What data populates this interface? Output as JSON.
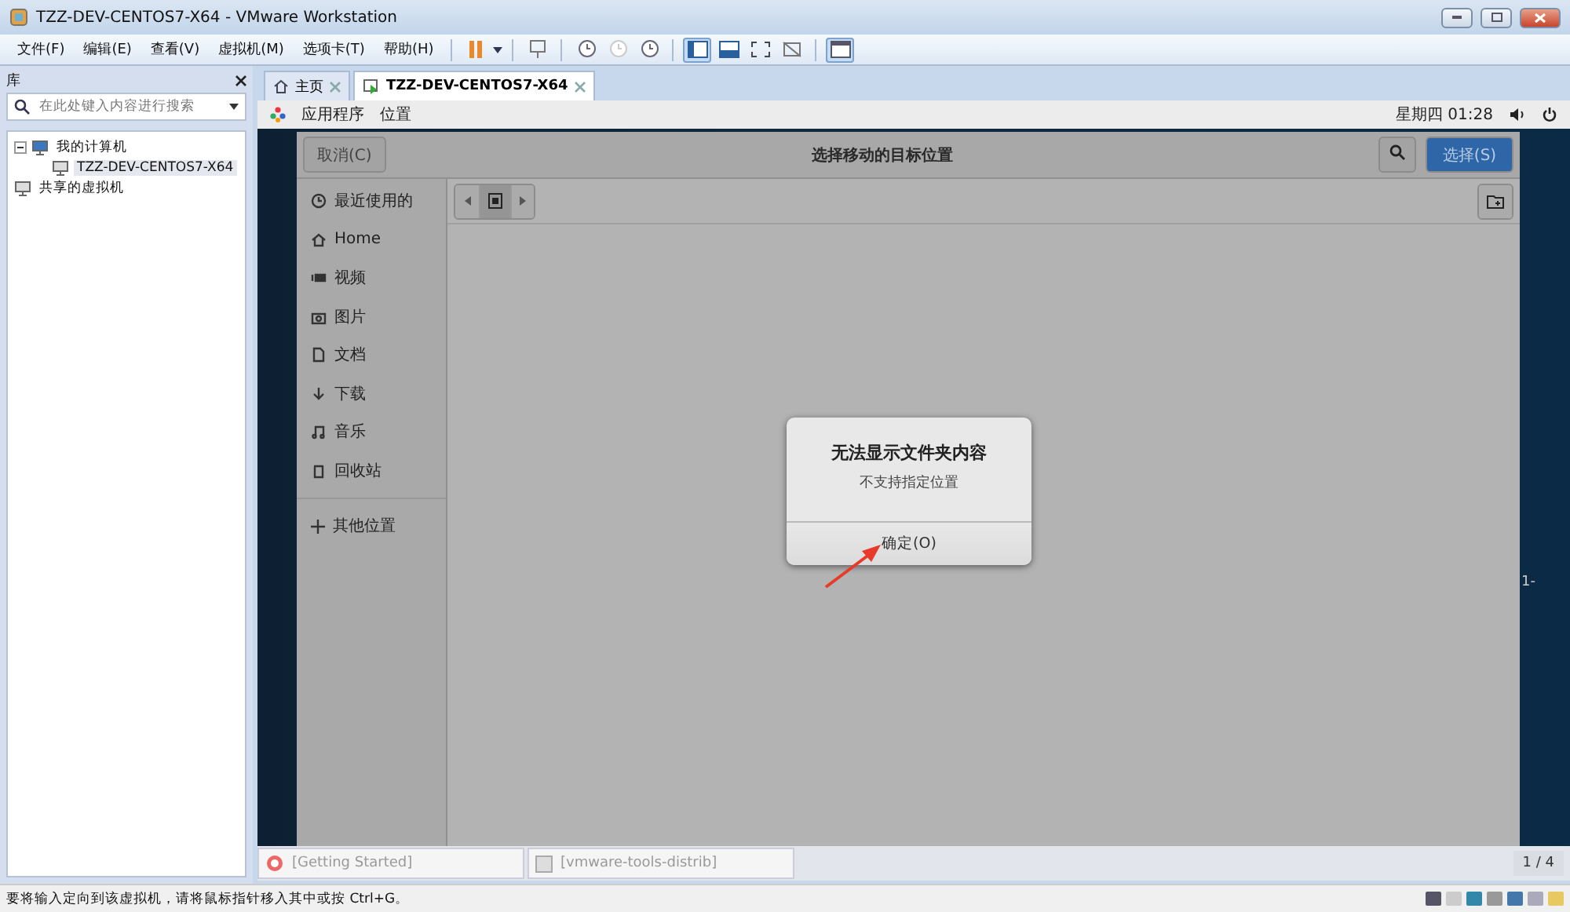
{
  "window": {
    "title": "TZZ-DEV-CENTOS7-X64 - VMware Workstation"
  },
  "menu": [
    "文件(F)",
    "编辑(E)",
    "查看(V)",
    "虚拟机(M)",
    "选项卡(T)",
    "帮助(H)"
  ],
  "library": {
    "title": "库",
    "search": {
      "placeholder": "在此处键入内容进行搜索"
    },
    "tree": [
      {
        "label": "我的计算机",
        "expanded": true,
        "children": [
          {
            "label": "TZZ-DEV-CENTOS7-X64",
            "selected": true
          }
        ]
      },
      {
        "label": "共享的虚拟机",
        "selected": false
      }
    ]
  },
  "tabs": [
    {
      "label": "主页",
      "selected": false
    },
    {
      "label": "TZZ-DEV-CENTOS7-X64",
      "selected": true
    }
  ],
  "guest_bar": {
    "apps": "应用程序",
    "places": "位置",
    "clock": "星期四 01:28"
  },
  "file_chooser": {
    "cancel": "取消(C)",
    "title": "选择移动的目标位置",
    "select": "选择(S)",
    "sidebar": [
      {
        "label": "最近使用的"
      },
      {
        "label": "Home"
      },
      {
        "label": "视频"
      },
      {
        "label": "图片"
      },
      {
        "label": "文档"
      },
      {
        "label": "下载"
      },
      {
        "label": "音乐"
      },
      {
        "label": "回收站"
      }
    ],
    "other_locations": "其他位置"
  },
  "error_dialog": {
    "title": "无法显示文件夹内容",
    "message": "不支持指定位置",
    "button": "确定(O)"
  },
  "desktop_text": "1-",
  "bottom_tabs": [
    {
      "label": "[Getting Started]"
    },
    {
      "label": "[vmware-tools-distrib]"
    }
  ],
  "page_counter": "1 / 4",
  "status_bar": "要将输入定向到该虚拟机，请将鼠标指针移入其中或按 Ctrl+G。"
}
